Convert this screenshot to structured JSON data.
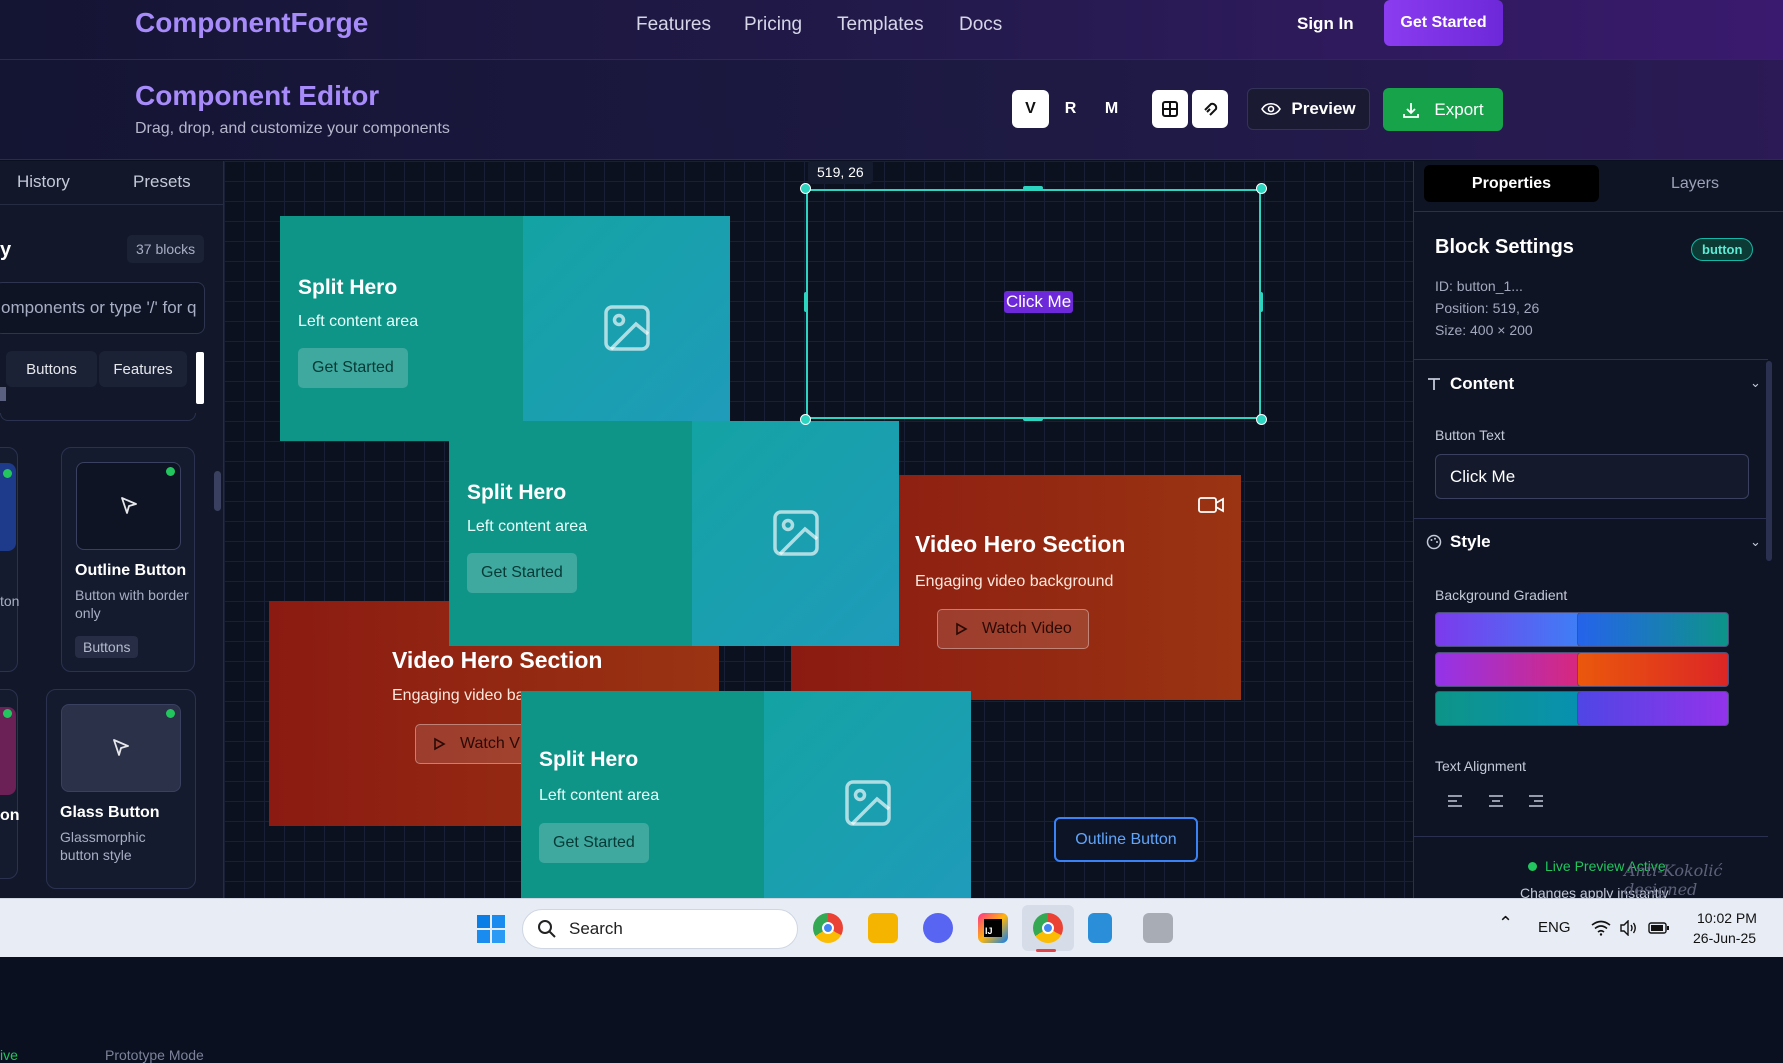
{
  "nav": {
    "brand": "ComponentForge",
    "links": [
      "Features",
      "Pricing",
      "Templates",
      "Docs"
    ],
    "sign_in": "Sign In",
    "get_started": "Get Started"
  },
  "editor": {
    "title": "Component Editor",
    "subtitle": "Drag, drop, and customize your components",
    "view_modes": [
      "V",
      "R",
      "M"
    ],
    "preview": "Preview",
    "export": "Export",
    "icons": [
      "grid-icon",
      "snap-icon",
      "eye-icon",
      "download-icon"
    ]
  },
  "left": {
    "tabs": [
      "History",
      "Presets"
    ],
    "library_title": "y",
    "count": "37 blocks",
    "search_placeholder": "omponents or type '/' for q",
    "categories": [
      "Buttons",
      "Features"
    ],
    "cards": [
      {
        "title": "Outline Button",
        "desc": "Button with border only",
        "tag": "Buttons"
      },
      {
        "title": "Glass Button",
        "desc": "Glassmorphic button style"
      }
    ],
    "partial_left_labels": [
      "ton",
      "on"
    ],
    "footer_live": "ive",
    "footer_mode": "Prototype Mode"
  },
  "canvas": {
    "coord_tag": "519, 26",
    "selected_text": "Click Me",
    "split": {
      "title": "Split Hero",
      "sub": "Left content area",
      "btn": "Get Started"
    },
    "video": {
      "title": "Video Hero Section",
      "sub": "Engaging video background",
      "btn": "Watch Video",
      "sub_clipped": "Engaging video ba",
      "btn_clipped": "Watch V"
    },
    "outline_btn": "Outline Button"
  },
  "right": {
    "tabs": [
      "Properties",
      "Layers"
    ],
    "block_title": "Block Settings",
    "badge": "button",
    "id": "ID: button_1...",
    "position": "Position: 519, 26",
    "size": "Size: 400 × 200",
    "content_section": "Content",
    "button_text_label": "Button Text",
    "button_text_value": "Click Me",
    "style_section": "Style",
    "bg_label": "Background Gradient",
    "swatches": [
      [
        "#7c3aed",
        "#3b82f6"
      ],
      [
        "#2563eb",
        "#0d9488"
      ],
      [
        "#9333ea",
        "#db2777"
      ],
      [
        "#ea580c",
        "#dc2626"
      ],
      [
        "#0d9488",
        "#0891b2"
      ],
      [
        "#4f46e5",
        "#9333ea"
      ]
    ],
    "text_align_label": "Text Alignment",
    "live": "Live Preview Active",
    "changes": "Changes apply instantly",
    "watermark": "Anti-Kokolić designed"
  },
  "taskbar": {
    "search": "Search",
    "lang": "ENG",
    "time": "10:02 PM",
    "date": "26-Jun-25"
  }
}
